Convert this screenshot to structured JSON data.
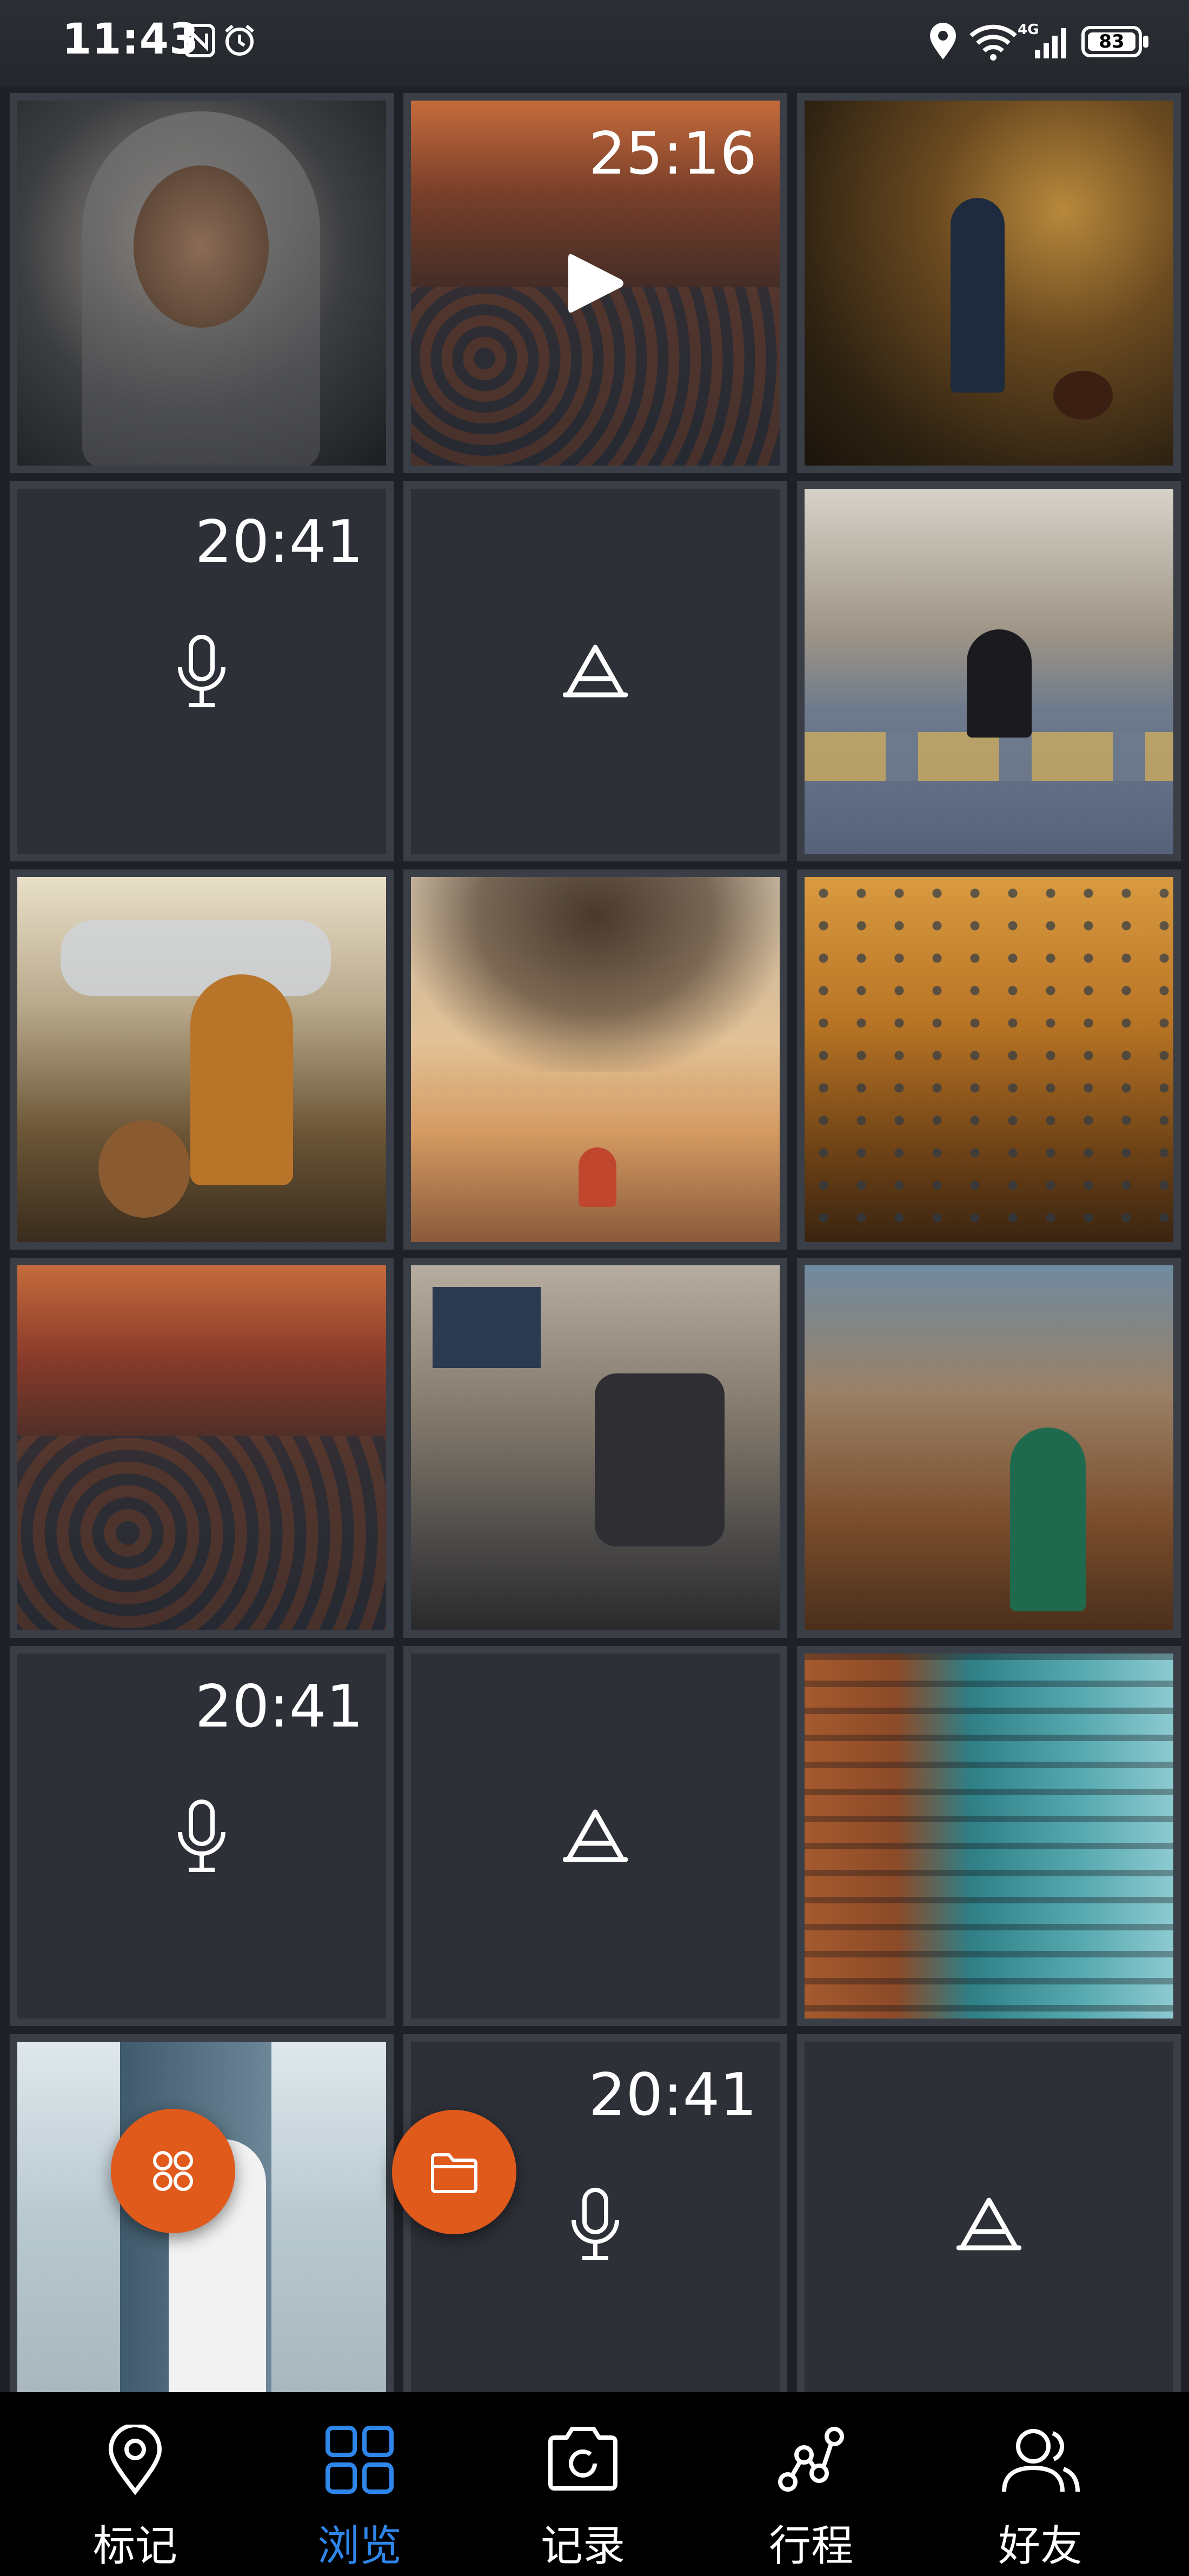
{
  "status_bar": {
    "time": "11:43",
    "battery": "83",
    "network": "4G",
    "icons": [
      "nfc-icon",
      "alarm-icon",
      "location-icon",
      "wifi-icon",
      "signal-icon",
      "battery-icon"
    ]
  },
  "grid": {
    "cells": [
      {
        "type": "photo",
        "subject": "elderly man portrait"
      },
      {
        "type": "video",
        "duration": "25:16",
        "subject": "crowded market street"
      },
      {
        "type": "photo",
        "subject": "boy and chicken in alley"
      },
      {
        "type": "audio",
        "duration": "20:41"
      },
      {
        "type": "text"
      },
      {
        "type": "photo",
        "subject": "woman sitting on street"
      },
      {
        "type": "photo",
        "subject": "child with puppy"
      },
      {
        "type": "photo",
        "subject": "tree by river at sunset"
      },
      {
        "type": "photo",
        "subject": "boats on golden river"
      },
      {
        "type": "photo",
        "subject": "market street"
      },
      {
        "type": "photo",
        "subject": "woman with stroller"
      },
      {
        "type": "photo",
        "subject": "woman in green shawl"
      },
      {
        "type": "audio",
        "duration": "20:41"
      },
      {
        "type": "text"
      },
      {
        "type": "photo",
        "subject": "city buildings"
      },
      {
        "type": "photo",
        "subject": "man by skyscraper"
      },
      {
        "type": "audio",
        "duration": "20:41"
      },
      {
        "type": "text"
      }
    ]
  },
  "fabs": {
    "left_icon": "apps-icon",
    "right_icon": "folder-icon",
    "color": "#e05a1c"
  },
  "bottom_nav": {
    "items": [
      {
        "label": "标记",
        "icon": "location-pin-icon"
      },
      {
        "label": "浏览",
        "icon": "grid-icon"
      },
      {
        "label": "记录",
        "icon": "camera-icon"
      },
      {
        "label": "行程",
        "icon": "route-icon"
      },
      {
        "label": "好友",
        "icon": "friends-icon"
      }
    ],
    "active_index": 1,
    "active_color": "#2f86ea"
  }
}
